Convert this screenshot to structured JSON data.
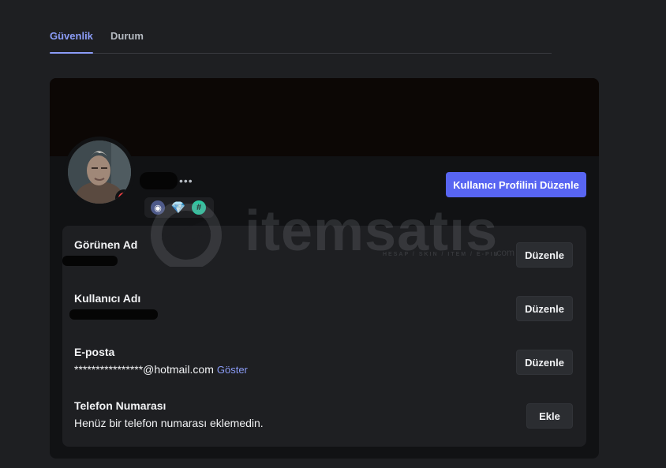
{
  "tabs": [
    {
      "label": "Güvenlik",
      "active": true
    },
    {
      "label": "Durum",
      "active": false
    }
  ],
  "profile": {
    "more_label": "•••",
    "edit_button": "Kullanıcı Profilini Düzenle",
    "status": "do-not-disturb",
    "badges": [
      "hypesquad-icon",
      "nitro-gem-icon",
      "active-developer-icon"
    ],
    "badge_glyphs": [
      "◉",
      "💎",
      "#"
    ]
  },
  "fields": {
    "display_name": {
      "label": "Görünen Ad",
      "button": "Düzenle"
    },
    "username": {
      "label": "Kullanıcı Adı",
      "button": "Düzenle"
    },
    "email": {
      "label": "E-posta",
      "value": "****************@hotmail.com",
      "reveal": "Göster",
      "button": "Düzenle"
    },
    "phone": {
      "label": "Telefon Numarası",
      "value": "Henüz bir telefon numarası eklemedin.",
      "button": "Ekle"
    }
  },
  "watermark": {
    "brand": "itemsatıs",
    "tagline": "HESAP / SKIN / ITEM / E-PIN",
    "domain": ".com"
  },
  "colors": {
    "accent": "#5865f2",
    "tab_active": "#8b9cf7",
    "dnd": "#f23f43",
    "background": "#1e1f22",
    "card": "#111214"
  }
}
